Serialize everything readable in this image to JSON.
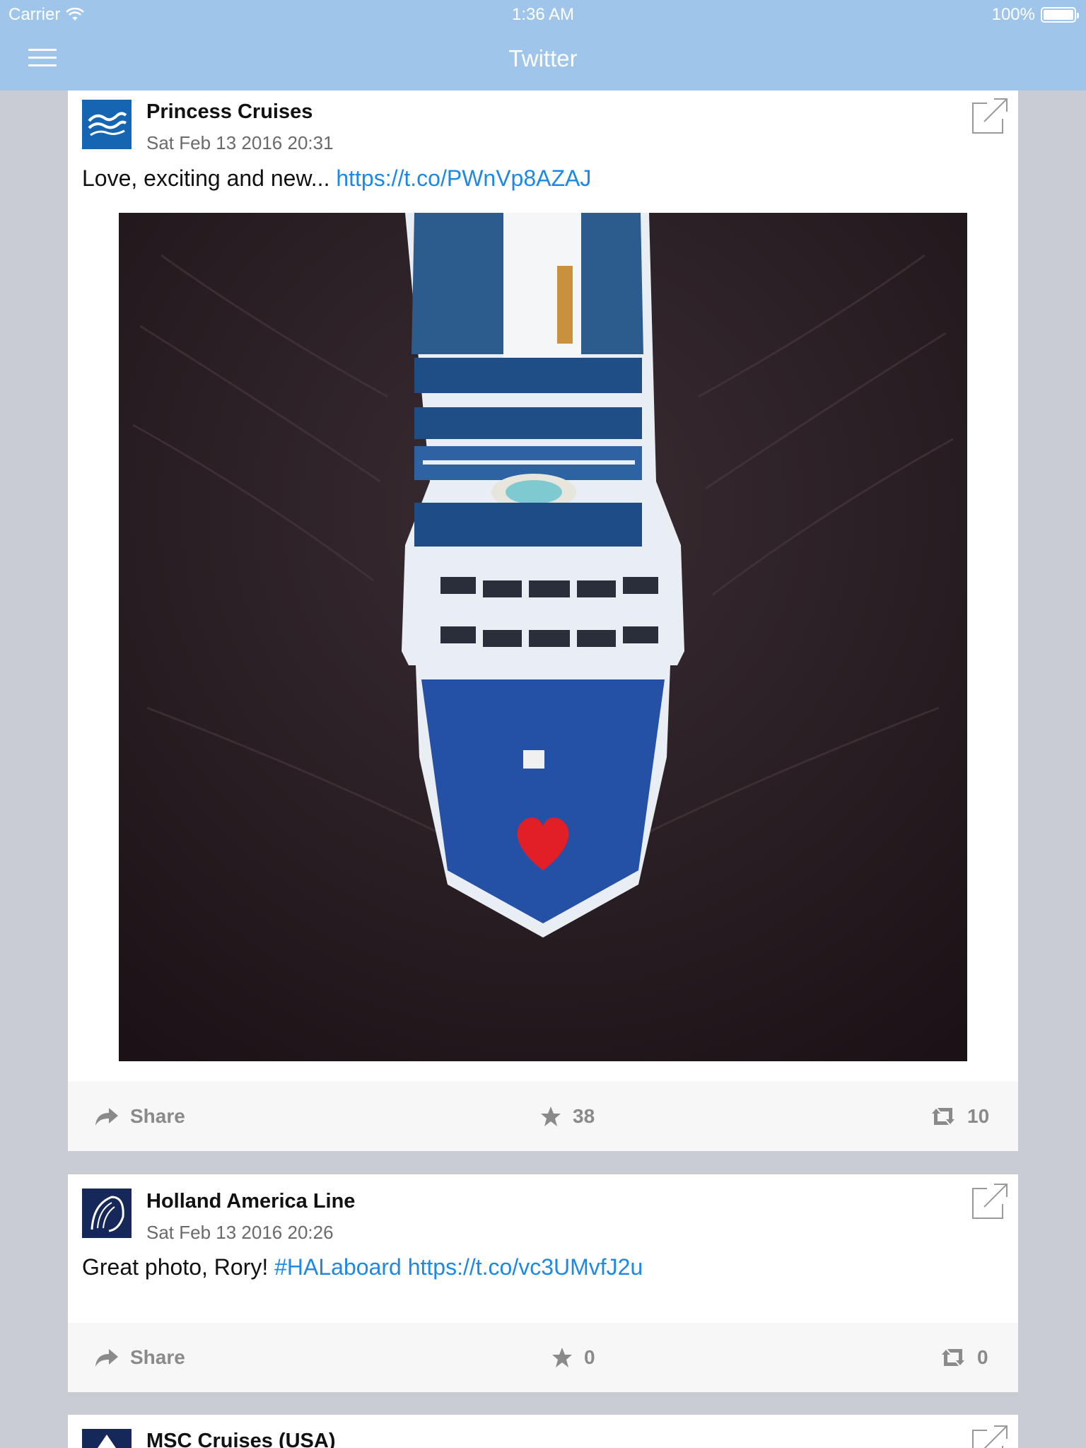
{
  "status_bar": {
    "carrier": "Carrier",
    "time": "1:36 AM",
    "battery": "100%"
  },
  "nav": {
    "title": "Twitter",
    "menu_icon": "hamburger-menu-icon"
  },
  "colors": {
    "nav_background": "#9fc6ea",
    "page_background": "#c9ccd3",
    "link": "#1e88e5",
    "action_text": "#8a8a8a"
  },
  "tweets": [
    {
      "author": "Princess Cruises",
      "timestamp": "Sat Feb 13 2016 20:31",
      "text": "Love, exciting and new...",
      "link": "https://t.co/PWnVp8AZAJ",
      "media": "cruise-ship-aerial-photo",
      "actions": {
        "share": "Share",
        "likes": "38",
        "retweets": "10"
      }
    },
    {
      "author": "Holland America Line",
      "timestamp": "Sat Feb 13 2016 20:26",
      "text": "Great photo, Rory!",
      "hashtag": "#HALaboard",
      "link": "https://t.co/vc3UMvfJ2u",
      "actions": {
        "share": "Share",
        "likes": "0",
        "retweets": "0"
      }
    },
    {
      "author": "MSC Cruises (USA)"
    }
  ]
}
